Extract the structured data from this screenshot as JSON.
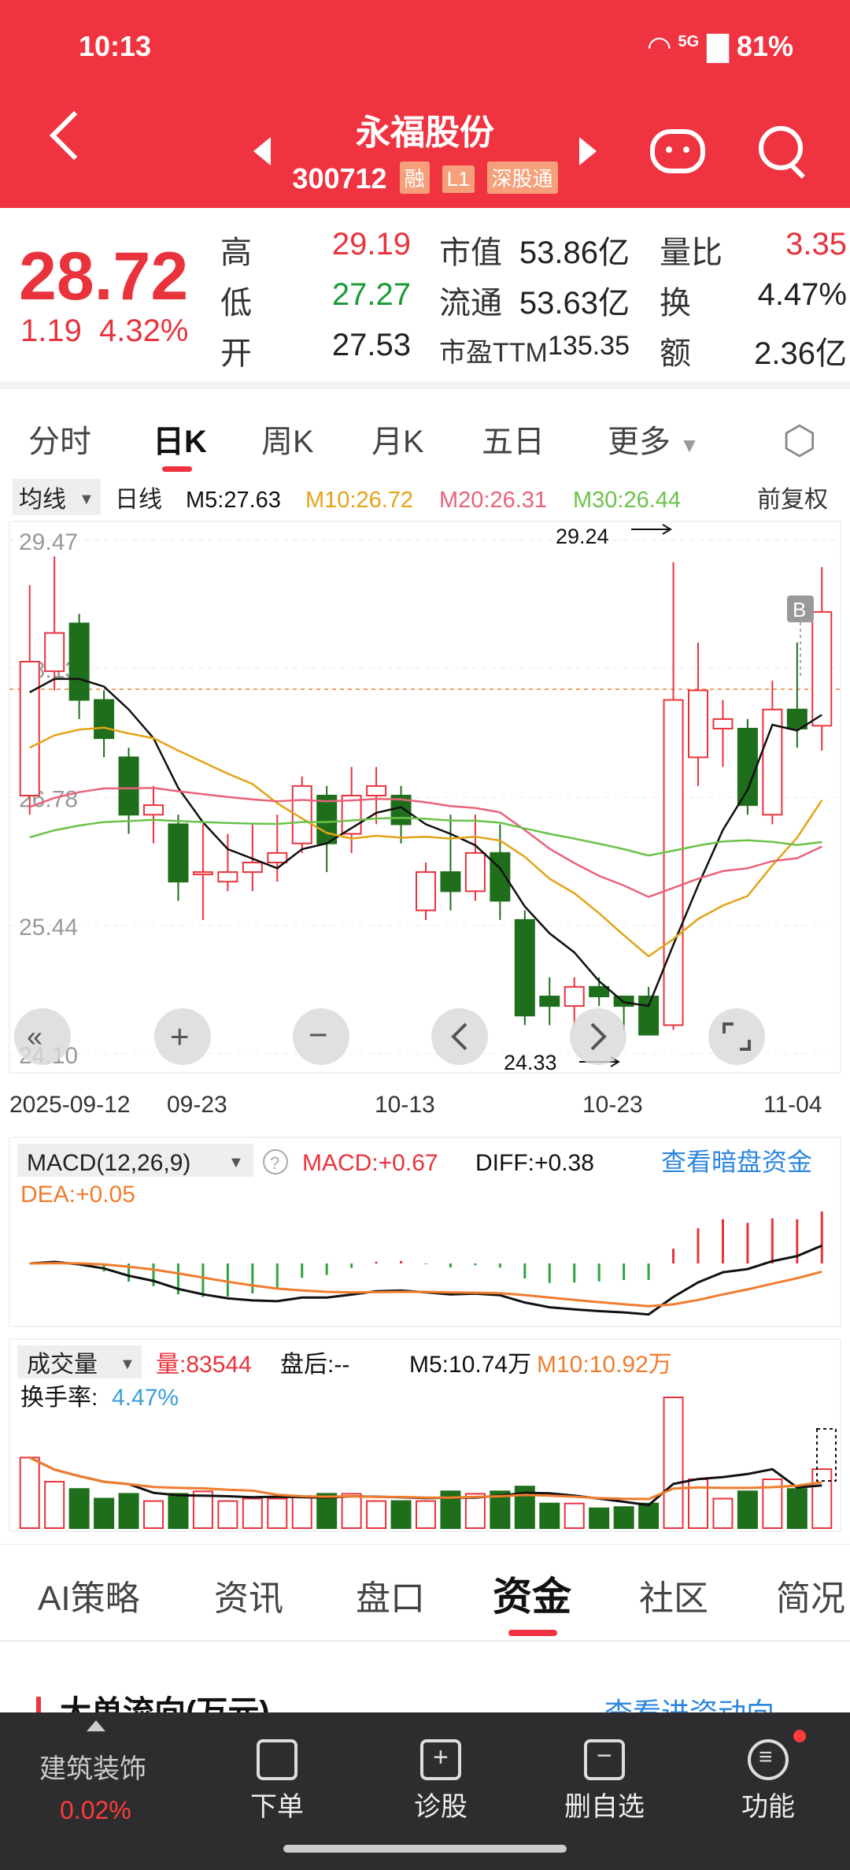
{
  "status": {
    "time": "10:13",
    "battery": "81%",
    "network": "5G"
  },
  "header": {
    "name": "永福股份",
    "code": "300712",
    "tags": [
      "融",
      "L1",
      "深股通"
    ]
  },
  "quote": {
    "price": "28.72",
    "change": "1.19",
    "pct": "4.32%",
    "high_label": "高",
    "high": "29.19",
    "low_label": "低",
    "low": "27.27",
    "open_label": "开",
    "open": "27.53",
    "mcap_label": "市值",
    "mcap": "53.86亿",
    "float_label": "流通",
    "float": "53.63亿",
    "pe_label": "市盈TTM",
    "pe": "135.35",
    "vr_label": "量比",
    "vr": "3.35",
    "turn_label": "换",
    "turn": "4.47%",
    "amt_label": "额",
    "amt": "2.36亿"
  },
  "period_tabs": [
    "分时",
    "日K",
    "周K",
    "月K",
    "五日",
    "更多"
  ],
  "ma_bar": {
    "ma_select": "均线",
    "period": "日线",
    "m5": "M5:27.63",
    "m10": "M10:26.72",
    "m20": "M20:26.31",
    "m30": "M30:26.44",
    "adjust": "前复权"
  },
  "price_axis": [
    "29.47",
    "28.13",
    "26.78",
    "25.44",
    "24.10"
  ],
  "annotations": {
    "high_mark": "29.24",
    "low_mark": "24.33",
    "b_mark": "B"
  },
  "date_axis": [
    "2025-09-12",
    "09-23",
    "10-13",
    "10-23",
    "11-04"
  ],
  "macd": {
    "label": "MACD(12,26,9)",
    "macd": "MACD:+0.67",
    "diff": "DIFF:+0.38",
    "dea": "DEA:+0.05",
    "link": "查看暗盘资金"
  },
  "volume": {
    "label": "成交量",
    "vol": "量:83544",
    "after": "盘后:--",
    "m5": "M5:10.74万",
    "m10": "M10:10.92万",
    "turnover_label": "换手率:",
    "turnover": "4.47%"
  },
  "bottom_tabs": [
    "AI策略",
    "资讯",
    "盘口",
    "资金",
    "社区",
    "简况"
  ],
  "partial_section": {
    "title": "大单流向(万元)",
    "link": "查看进资动向"
  },
  "nav": {
    "sector": "建筑装饰",
    "sector_pct": "0.02%",
    "items": [
      "下单",
      "诊股",
      "删自选",
      "功能"
    ]
  },
  "colors": {
    "up": "#e8333d",
    "down": "#1f6e1c",
    "brand": "#ef3340",
    "m5": "#111111",
    "m10": "#e3a316",
    "m20": "#e8637a",
    "m30": "#6bc24a"
  },
  "chart_data": {
    "type": "candlestick",
    "candles": [
      {
        "o": 26.8,
        "c": 28.2,
        "h": 29.0,
        "l": 26.6
      },
      {
        "o": 28.1,
        "c": 28.5,
        "h": 29.3,
        "l": 27.9
      },
      {
        "o": 28.6,
        "c": 27.8,
        "h": 28.7,
        "l": 27.6
      },
      {
        "o": 27.8,
        "c": 27.4,
        "h": 27.9,
        "l": 27.2
      },
      {
        "o": 27.2,
        "c": 26.6,
        "h": 27.3,
        "l": 26.4
      },
      {
        "o": 26.6,
        "c": 26.7,
        "h": 26.9,
        "l": 26.3
      },
      {
        "o": 26.5,
        "c": 25.9,
        "h": 26.6,
        "l": 25.7
      },
      {
        "o": 26.0,
        "c": 26.0,
        "h": 26.5,
        "l": 25.5
      },
      {
        "o": 25.9,
        "c": 26.0,
        "h": 26.4,
        "l": 25.8
      },
      {
        "o": 26.0,
        "c": 26.1,
        "h": 26.5,
        "l": 25.8
      },
      {
        "o": 26.1,
        "c": 26.2,
        "h": 26.6,
        "l": 25.9
      },
      {
        "o": 26.3,
        "c": 26.9,
        "h": 27.0,
        "l": 26.2
      },
      {
        "o": 26.8,
        "c": 26.3,
        "h": 26.9,
        "l": 26.0
      },
      {
        "o": 26.4,
        "c": 26.8,
        "h": 27.1,
        "l": 26.2
      },
      {
        "o": 26.8,
        "c": 26.9,
        "h": 27.1,
        "l": 26.5
      },
      {
        "o": 26.8,
        "c": 26.5,
        "h": 26.9,
        "l": 26.3
      },
      {
        "o": 25.6,
        "c": 26.0,
        "h": 26.1,
        "l": 25.5
      },
      {
        "o": 26.0,
        "c": 25.8,
        "h": 26.6,
        "l": 25.6
      },
      {
        "o": 25.8,
        "c": 26.2,
        "h": 26.6,
        "l": 25.7
      },
      {
        "o": 26.2,
        "c": 25.7,
        "h": 26.5,
        "l": 25.5
      },
      {
        "o": 25.5,
        "c": 24.5,
        "h": 25.6,
        "l": 24.4
      },
      {
        "o": 24.7,
        "c": 24.6,
        "h": 24.9,
        "l": 24.4
      },
      {
        "o": 24.6,
        "c": 24.8,
        "h": 24.9,
        "l": 24.4
      },
      {
        "o": 24.8,
        "c": 24.7,
        "h": 24.9,
        "l": 24.6
      },
      {
        "o": 24.7,
        "c": 24.6,
        "h": 24.7,
        "l": 24.35
      },
      {
        "o": 24.7,
        "c": 24.3,
        "h": 24.8,
        "l": 24.3
      },
      {
        "o": 24.4,
        "c": 27.8,
        "h": 29.24,
        "l": 24.35
      },
      {
        "o": 27.2,
        "c": 27.9,
        "h": 28.4,
        "l": 26.9
      },
      {
        "o": 27.5,
        "c": 27.6,
        "h": 27.8,
        "l": 27.1
      },
      {
        "o": 27.5,
        "c": 26.7,
        "h": 27.6,
        "l": 26.6
      },
      {
        "o": 26.6,
        "c": 27.7,
        "h": 28.0,
        "l": 26.5
      },
      {
        "o": 27.7,
        "c": 27.5,
        "h": 28.4,
        "l": 27.3
      },
      {
        "o": 27.53,
        "c": 28.72,
        "h": 29.19,
        "l": 27.27
      }
    ],
    "volume_m5": "10.74万",
    "volume_m10": "10.92万"
  }
}
